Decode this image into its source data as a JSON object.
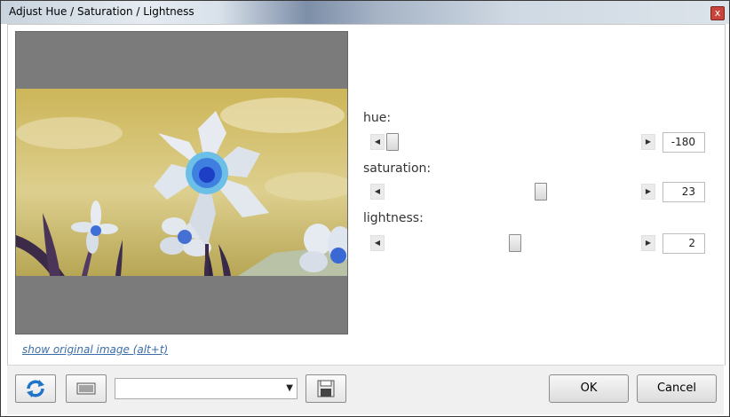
{
  "window": {
    "title": "Adjust Hue / Saturation / Lightness",
    "close_glyph": "x"
  },
  "sliders": [
    {
      "label": "hue:",
      "value": "-180",
      "position_fraction": 0.0
    },
    {
      "label": "saturation:",
      "value": "23",
      "position_fraction": 0.58
    },
    {
      "label": "lightness:",
      "value": "2",
      "position_fraction": 0.51
    }
  ],
  "preview": {
    "link_text": "show original image (alt+t)"
  },
  "footer": {
    "refresh_icon": "refresh-icon",
    "pattern_icon": "barcode-icon",
    "preset_value": "",
    "save_icon": "save-icon",
    "ok_label": "OK",
    "cancel_label": "Cancel"
  }
}
